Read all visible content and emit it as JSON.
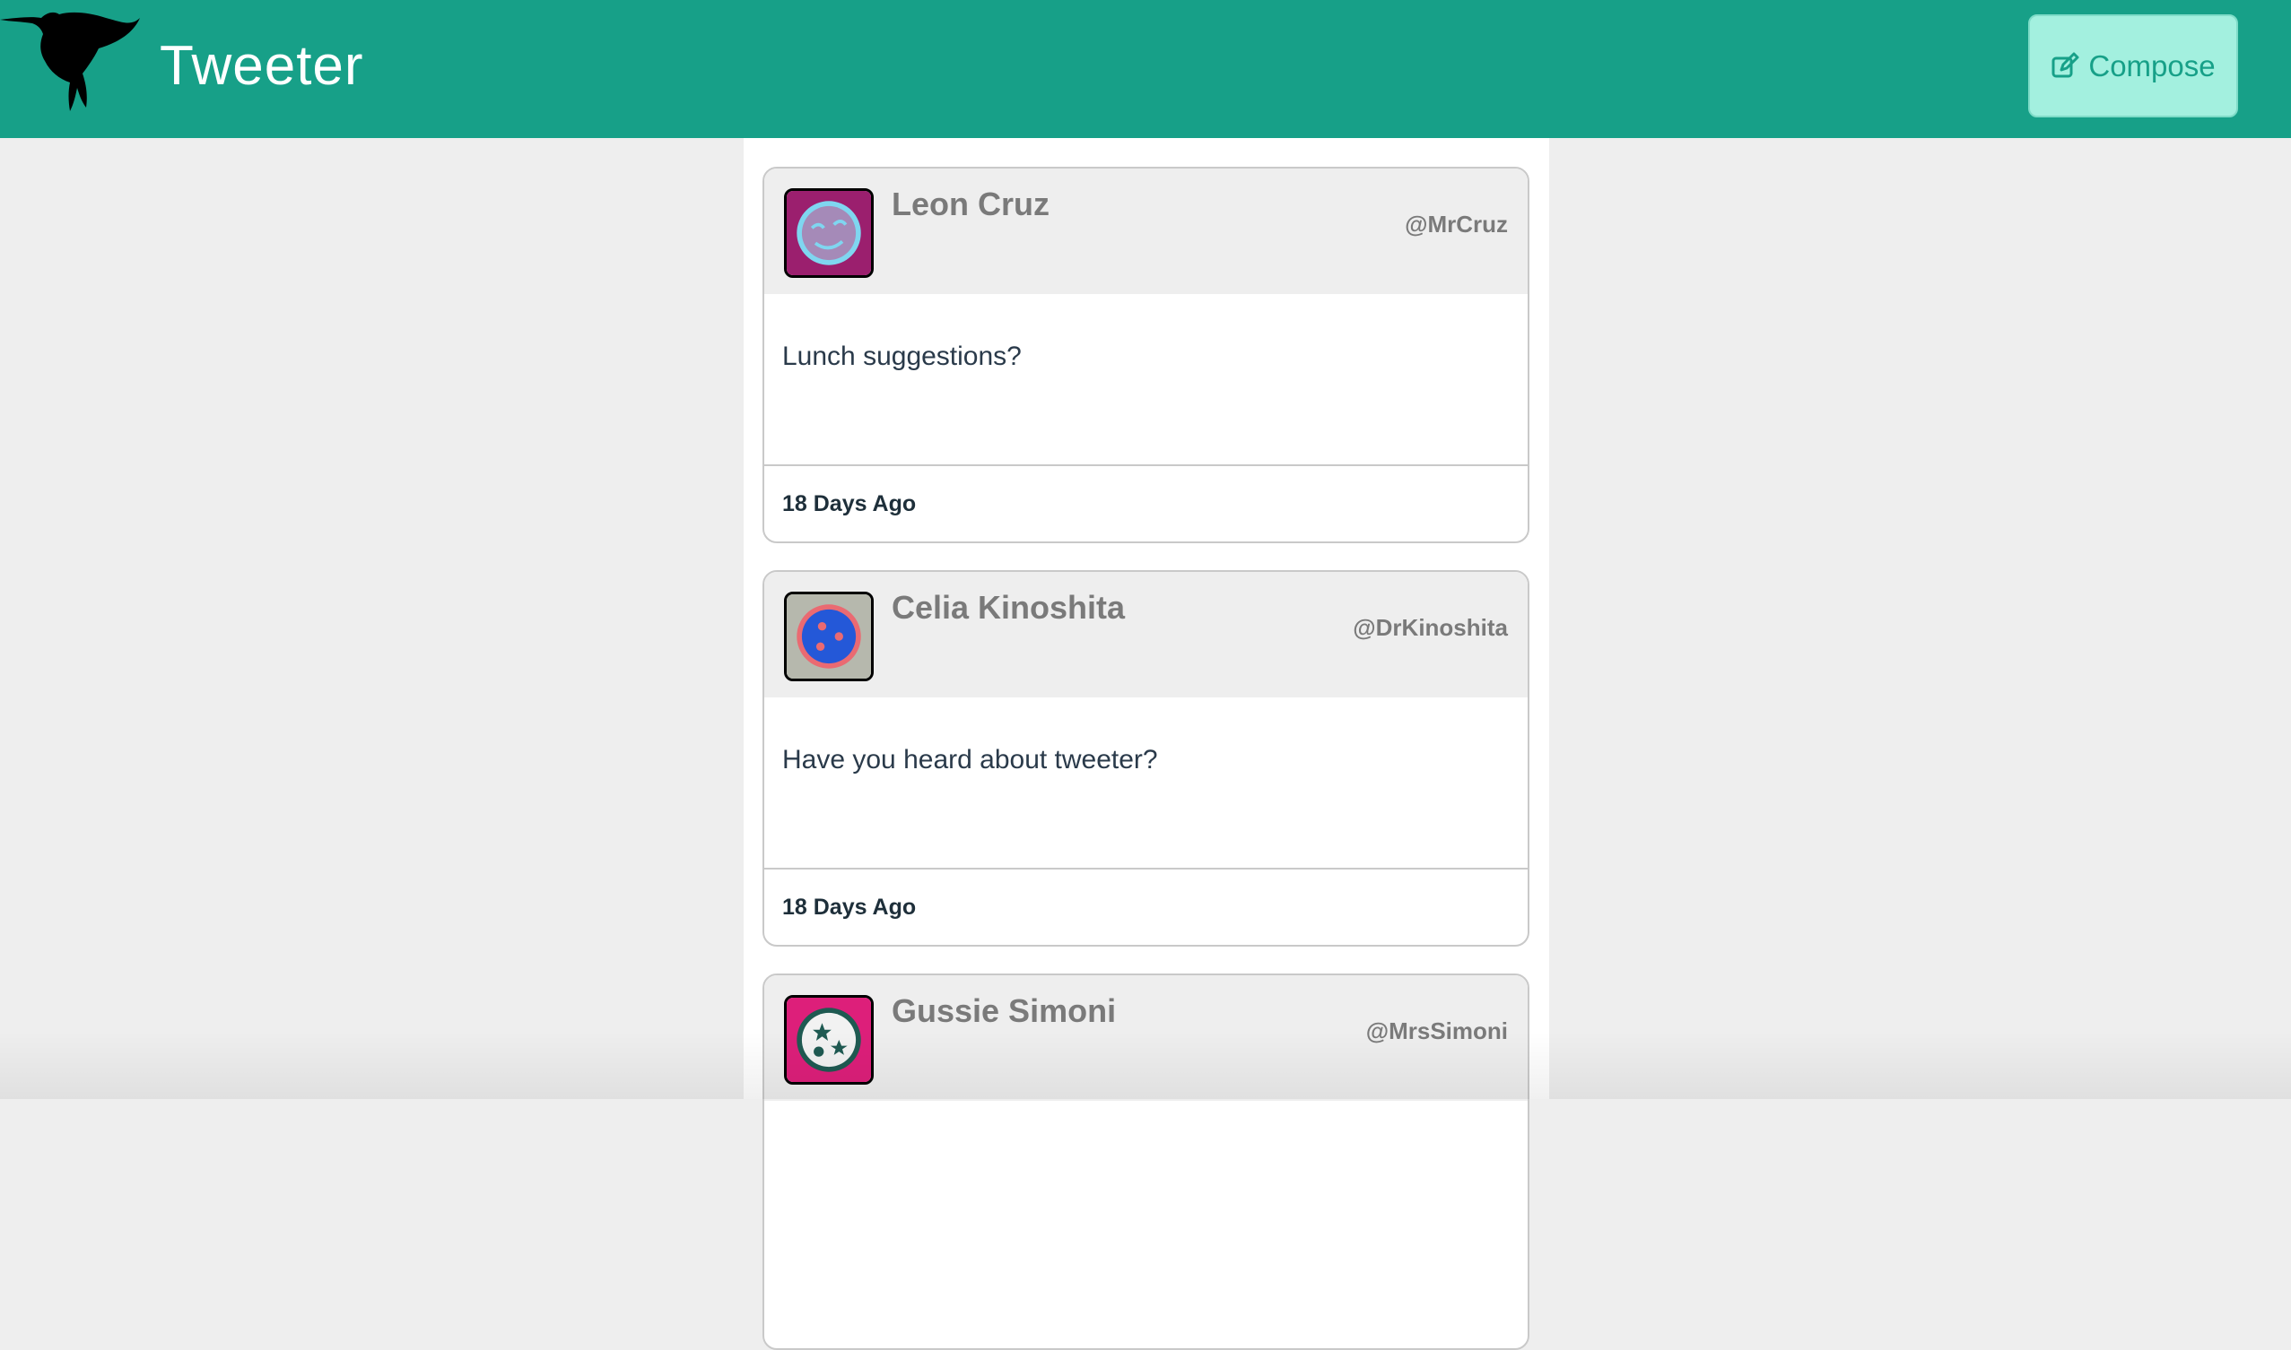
{
  "colors": {
    "nav_bg": "#17a088",
    "compose_bg": "#a3f0df",
    "page_bg": "#eeeeee",
    "avatar_leon_bg": "#9b1f6e",
    "avatar_celia_bg": "#b6b8ad",
    "avatar_gussie_bg": "#dd1f7a"
  },
  "header": {
    "logo_icon": "hummingbird-silhouette-icon",
    "title": "Tweeter",
    "compose_icon": "edit-icon",
    "compose_label": "Compose"
  },
  "tweets": [
    {
      "name": "Leon Cruz",
      "handle": "@MrCruz",
      "text": "Lunch suggestions?",
      "time": "18 Days Ago"
    },
    {
      "name": "Celia Kinoshita",
      "handle": "@DrKinoshita",
      "text": "Have you heard about tweeter?",
      "time": "18 Days Ago"
    },
    {
      "name": "Gussie Simoni",
      "handle": "@MrsSimoni",
      "text": "",
      "time": ""
    }
  ]
}
